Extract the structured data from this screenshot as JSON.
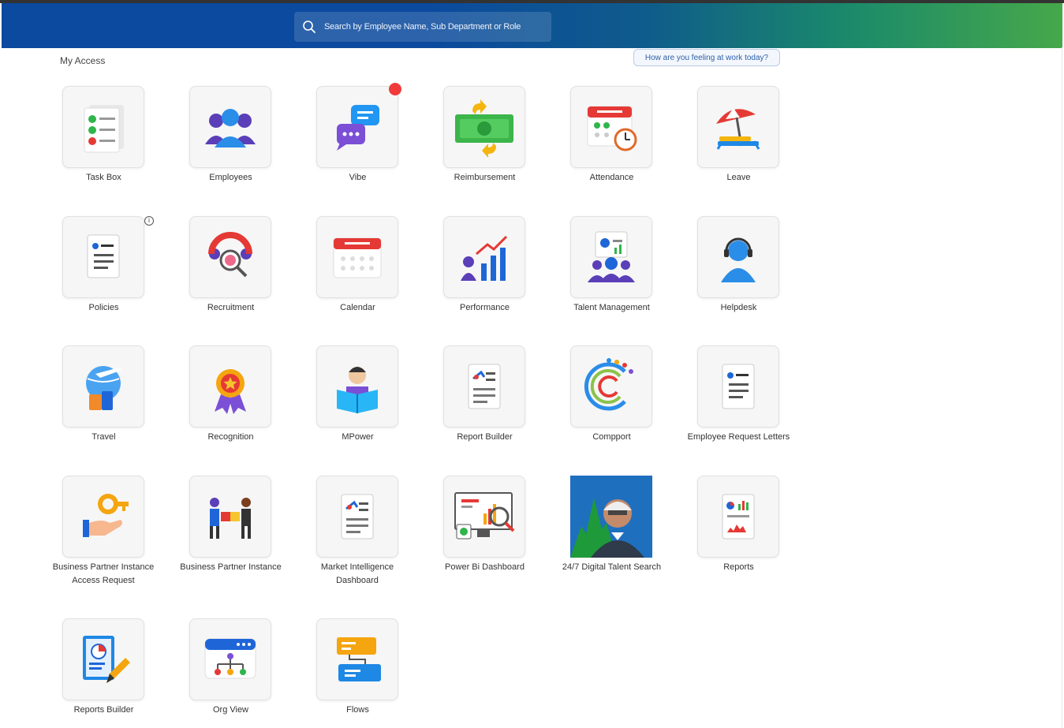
{
  "search": {
    "placeholder": "Search by Employee Name, Sub Department or Role"
  },
  "section_title": "My Access",
  "mood_prompt": "How are you feeling at work today?",
  "tiles": [
    {
      "label": "Task Box",
      "icon": "task-box-icon"
    },
    {
      "label": "Employees",
      "icon": "employees-icon"
    },
    {
      "label": "Vibe",
      "icon": "vibe-chat-icon",
      "notification": true
    },
    {
      "label": "Reimbursement",
      "icon": "reimbursement-money-icon"
    },
    {
      "label": "Attendance",
      "icon": "attendance-calendar-clock-icon"
    },
    {
      "label": "Leave",
      "icon": "beach-umbrella-icon"
    },
    {
      "label": "Policies",
      "icon": "policies-document-icon",
      "info": true
    },
    {
      "label": "Recruitment",
      "icon": "recruitment-search-icon"
    },
    {
      "label": "Calendar",
      "icon": "calendar-icon"
    },
    {
      "label": "Performance",
      "icon": "performance-chart-icon"
    },
    {
      "label": "Talent Management",
      "icon": "talent-management-icon"
    },
    {
      "label": "Helpdesk",
      "icon": "helpdesk-headset-icon"
    },
    {
      "label": "Travel",
      "icon": "travel-globe-icon"
    },
    {
      "label": "Recognition",
      "icon": "recognition-badge-icon"
    },
    {
      "label": "MPower",
      "icon": "mpower-reader-icon"
    },
    {
      "label": "Report Builder",
      "icon": "report-builder-icon"
    },
    {
      "label": "Compport",
      "icon": "compport-logo-icon"
    },
    {
      "label": "Employee Request Letters",
      "icon": "request-letters-icon"
    },
    {
      "label": "Business Partner Instance Access Request",
      "icon": "key-hand-icon"
    },
    {
      "label": "Business Partner Instance",
      "icon": "partner-puzzle-icon"
    },
    {
      "label": "Market Intelligence Dashboard",
      "icon": "market-intelligence-icon"
    },
    {
      "label": "Power Bi Dashboard",
      "icon": "powerbi-dashboard-icon"
    },
    {
      "label": "24/7 Digital Talent Search",
      "icon": "digital-talent-photo-icon"
    },
    {
      "label": "Reports",
      "icon": "reports-icon"
    },
    {
      "label": "Reports Builder",
      "icon": "reports-builder-pencil-icon"
    },
    {
      "label": "Org View",
      "icon": "org-chart-icon"
    },
    {
      "label": "Flows",
      "icon": "flows-icon"
    }
  ],
  "colors": {
    "header_start": "#0b4a9e",
    "header_end": "#46a84a",
    "notification": "#f03a3a"
  }
}
